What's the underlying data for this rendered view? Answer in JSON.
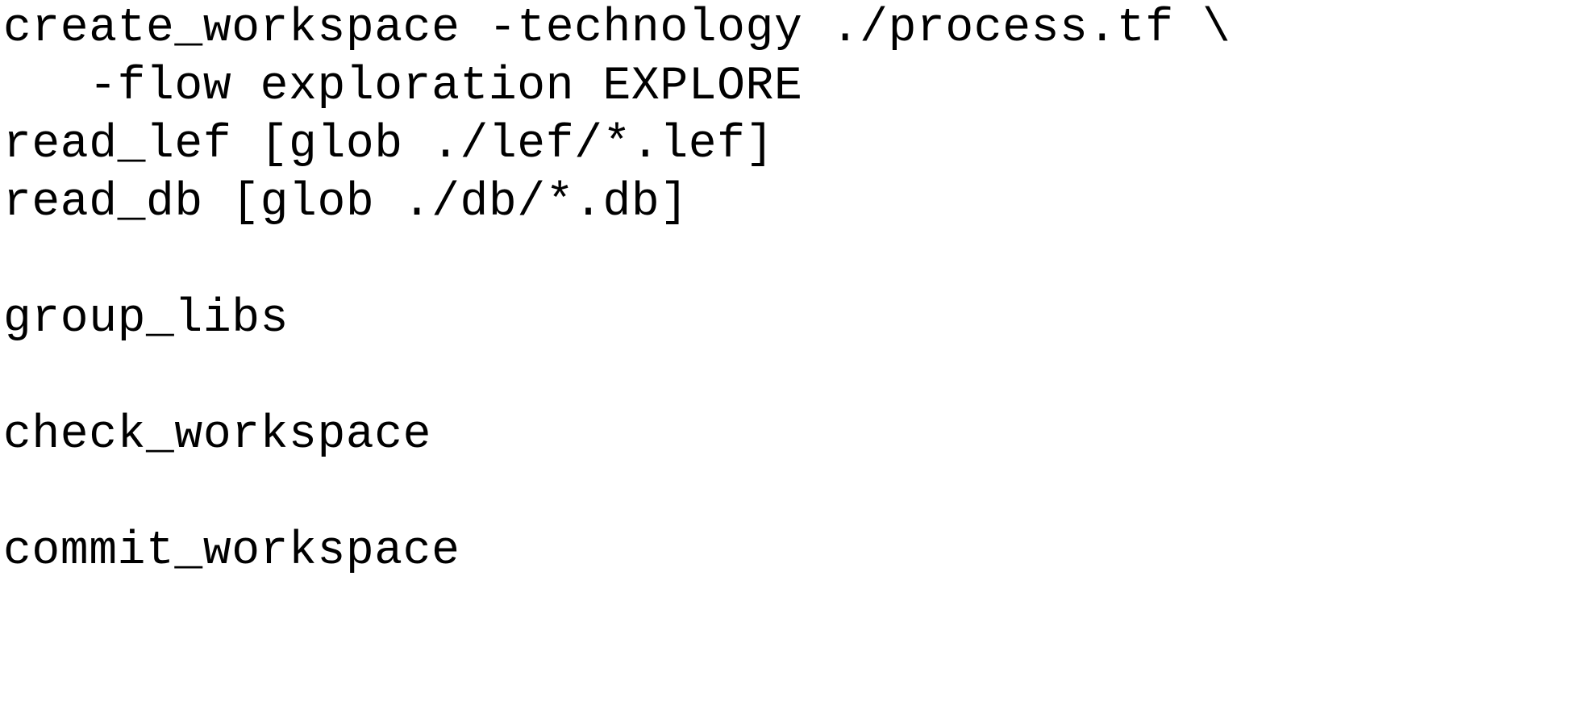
{
  "document": {
    "kind": "plain-text-code-listing",
    "language": "tcl",
    "background_color": "#ffffff",
    "text_color": "#000000",
    "lines": [
      "create_workspace -technology ./process.tf \\",
      "   -flow exploration EXPLORE",
      "read_lef [glob ./lef/*.lef]",
      "read_db [glob ./db/*.db]",
      "",
      "group_libs",
      "",
      "check_workspace",
      "",
      "commit_workspace"
    ],
    "line_names": [
      "line-create-workspace",
      "line-flow-exploration",
      "line-read-lef",
      "line-read-db",
      "line-blank-1",
      "line-group-libs",
      "line-blank-2",
      "line-check-workspace",
      "line-blank-3",
      "line-commit-workspace"
    ]
  }
}
